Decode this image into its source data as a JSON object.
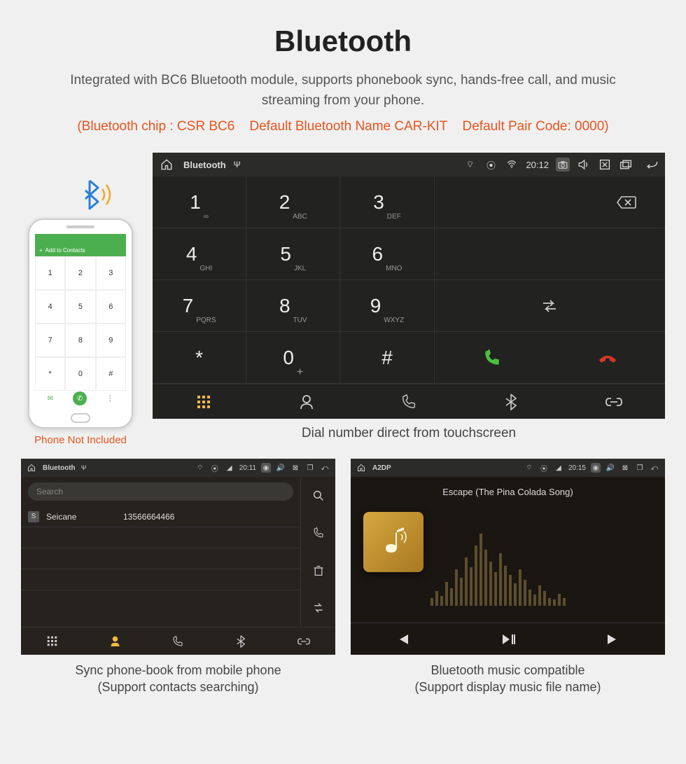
{
  "header": {
    "title": "Bluetooth",
    "subtitle": "Integrated with BC6 Bluetooth module, supports phonebook sync, hands-free call, and music streaming from your phone.",
    "orange_note": "(Bluetooth chip : CSR BC6    Default Bluetooth Name CAR-KIT    Default Pair Code: 0000)"
  },
  "phone_mock": {
    "add_label": "Add to Contacts",
    "keys": [
      "1",
      "2",
      "3",
      "4",
      "5",
      "6",
      "7",
      "8",
      "9",
      "*",
      "0",
      "#"
    ],
    "caption": "Phone Not Included"
  },
  "dialer": {
    "status": {
      "title": "Bluetooth",
      "time": "20:12"
    },
    "keys": [
      {
        "n": "1",
        "s": "∞"
      },
      {
        "n": "2",
        "s": "ABC"
      },
      {
        "n": "3",
        "s": "DEF"
      },
      {
        "n": "4",
        "s": "GHI"
      },
      {
        "n": "5",
        "s": "JKL"
      },
      {
        "n": "6",
        "s": "MNO"
      },
      {
        "n": "7",
        "s": "PQRS"
      },
      {
        "n": "8",
        "s": "TUV"
      },
      {
        "n": "9",
        "s": "WXYZ"
      },
      {
        "n": "*",
        "s": ""
      },
      {
        "n": "0",
        "s": "+"
      },
      {
        "n": "#",
        "s": ""
      }
    ],
    "caption": "Dial number direct from touchscreen"
  },
  "phonebook": {
    "status_title": "Bluetooth",
    "status_time": "20:11",
    "search_placeholder": "Search",
    "contact_badge": "S",
    "contact_name": "Seicane",
    "contact_number": "13566664466",
    "caption_l1": "Sync phone-book from mobile phone",
    "caption_l2": "(Support contacts searching)"
  },
  "a2dp": {
    "status_title": "A2DP",
    "status_time": "20:15",
    "track": "Escape (The Pina Colada Song)",
    "caption_l1": "Bluetooth music compatible",
    "caption_l2": "(Support display music file name)"
  }
}
